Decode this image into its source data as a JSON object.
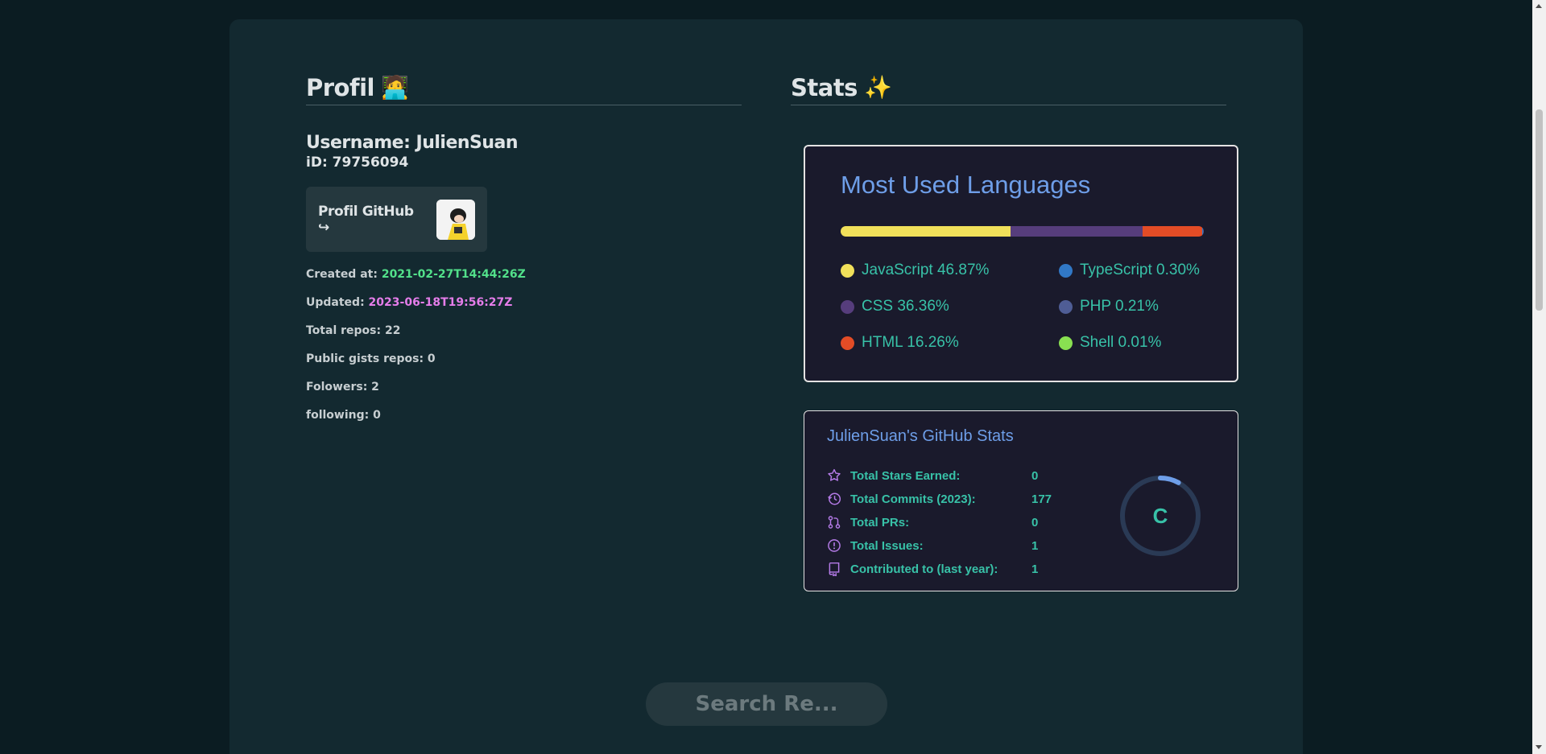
{
  "profile": {
    "title": "Profil",
    "title_emoji": "🧑‍💻",
    "username": "Username: JulienSuan",
    "id": "iD: 79756094",
    "github_button": "Profil GitHub ↪",
    "created_label": "Created at:",
    "created_value": "2021-02-27T14:44:26Z",
    "updated_label": "Updated:",
    "updated_value": "2023-06-18T19:56:27Z",
    "total_repos": "Total repos: 22",
    "public_gists": "Public gists repos: 0",
    "followers": "Folowers: 2",
    "following": "following: 0"
  },
  "stats": {
    "title": "Stats",
    "title_emoji": "✨"
  },
  "languages": {
    "title": "Most Used Languages",
    "items": [
      {
        "label": "JavaScript 46.87%",
        "color": "#f1e05a",
        "percent": 46.87
      },
      {
        "label": "TypeScript 0.30%",
        "color": "#3178c6",
        "percent": 0.3
      },
      {
        "label": "CSS 36.36%",
        "color": "#563d7c",
        "percent": 36.36
      },
      {
        "label": "PHP 0.21%",
        "color": "#4f5d95",
        "percent": 0.21
      },
      {
        "label": "HTML 16.26%",
        "color": "#e34c26",
        "percent": 16.26
      },
      {
        "label": "Shell 0.01%",
        "color": "#89e051",
        "percent": 0.01
      }
    ]
  },
  "github_stats": {
    "title": "JulienSuan's GitHub Stats",
    "rows": [
      {
        "icon": "star-icon",
        "label": "Total Stars Earned:",
        "value": "0"
      },
      {
        "icon": "history-icon",
        "label": "Total Commits (2023):",
        "value": "177"
      },
      {
        "icon": "pull-request-icon",
        "label": "Total PRs:",
        "value": "0"
      },
      {
        "icon": "issue-icon",
        "label": "Total Issues:",
        "value": "1"
      },
      {
        "icon": "repo-icon",
        "label": "Contributed to (last year):",
        "value": "1"
      }
    ],
    "rank": "C",
    "rank_progress": 0.08
  },
  "search": {
    "placeholder": "Search Re..."
  },
  "colors": {
    "background": "#0b1c22",
    "card": "#132930",
    "accent_blue": "#6e9ee8",
    "accent_teal": "#38c2a8",
    "created_green": "#52e08a",
    "updated_pink": "#e57dea"
  }
}
